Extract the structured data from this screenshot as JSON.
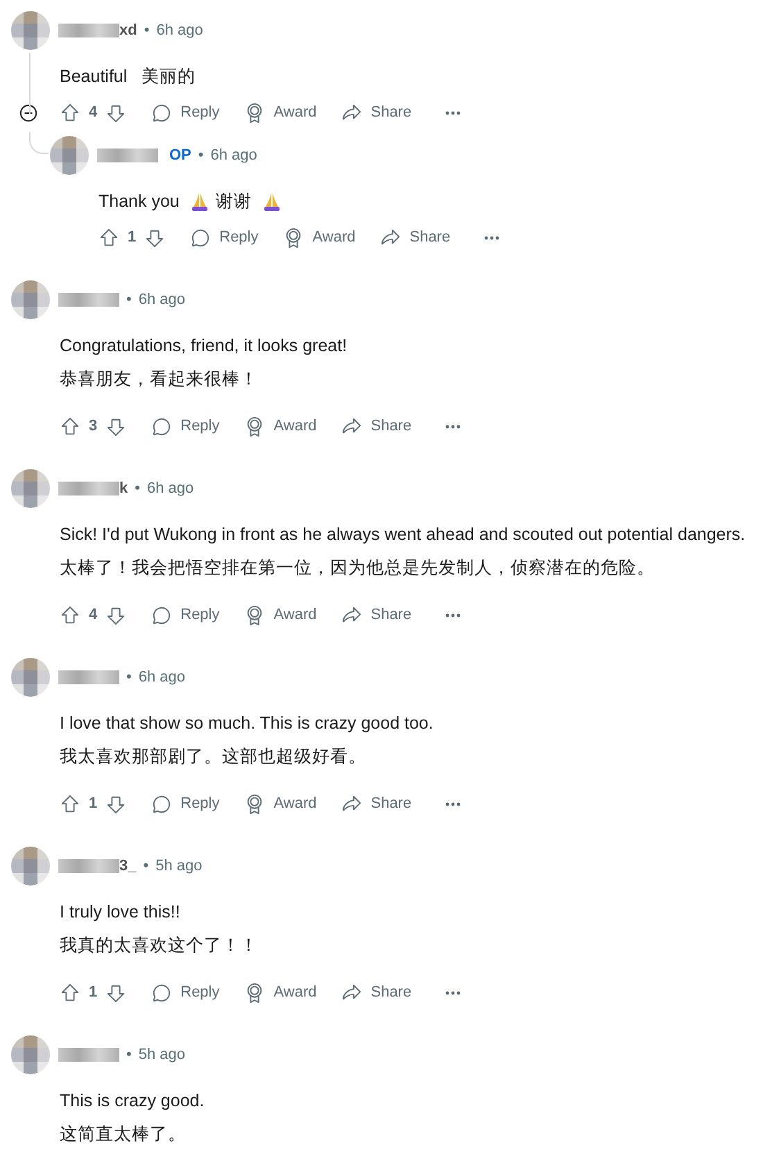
{
  "comments": [
    {
      "username_visible": "xd",
      "separator": "•",
      "time": "6h ago",
      "expanded": true,
      "lines": [
        [
          {
            "kind": "text",
            "text": "Beautiful   美丽的"
          }
        ]
      ],
      "score": "4",
      "actions": [
        "Reply",
        "Award",
        "Share"
      ],
      "replies": [
        {
          "op_label": "OP",
          "separator": "•",
          "time": "6h ago",
          "lines": [
            [
              {
                "kind": "text",
                "text": "Thank you"
              },
              {
                "kind": "pray-icon"
              },
              {
                "kind": "text",
                "text": "谢谢"
              },
              {
                "kind": "pray-icon"
              }
            ]
          ],
          "score": "1",
          "actions": [
            "Reply",
            "Award",
            "Share"
          ]
        }
      ]
    },
    {
      "separator": "•",
      "time": "6h ago",
      "lines": [
        [
          {
            "kind": "text",
            "text": "Congratulations, friend, it looks great!"
          }
        ],
        [
          {
            "kind": "text",
            "text": "恭喜朋友，看起来很棒！"
          }
        ]
      ],
      "score": "3",
      "actions": [
        "Reply",
        "Award",
        "Share"
      ]
    },
    {
      "username_visible": "k",
      "separator": "•",
      "time": "6h ago",
      "lines": [
        [
          {
            "kind": "text",
            "text": "Sick! I'd put Wukong in front as he always went ahead and scouted out potential dangers."
          }
        ],
        [
          {
            "kind": "text",
            "text": "太棒了！我会把悟空排在第一位，因为他总是先发制人，侦察潜在的危险。"
          }
        ]
      ],
      "score": "4",
      "actions": [
        "Reply",
        "Award",
        "Share"
      ]
    },
    {
      "separator": "•",
      "time": "6h ago",
      "lines": [
        [
          {
            "kind": "text",
            "text": "I love that show so much. This is crazy good too."
          }
        ],
        [
          {
            "kind": "text",
            "text": "我太喜欢那部剧了。这部也超级好看。"
          }
        ]
      ],
      "score": "1",
      "actions": [
        "Reply",
        "Award",
        "Share"
      ]
    },
    {
      "username_visible": "3_",
      "separator": "•",
      "time": "5h ago",
      "lines": [
        [
          {
            "kind": "text",
            "text": "I truly love this!!"
          }
        ],
        [
          {
            "kind": "text",
            "text": "我真的太喜欢这个了！！"
          }
        ]
      ],
      "score": "1",
      "actions": [
        "Reply",
        "Award",
        "Share"
      ]
    },
    {
      "separator": "•",
      "time": "5h ago",
      "lines": [
        [
          {
            "kind": "text",
            "text": "This is crazy good."
          }
        ],
        [
          {
            "kind": "text",
            "text": "这简直太棒了。"
          }
        ]
      ]
    }
  ]
}
